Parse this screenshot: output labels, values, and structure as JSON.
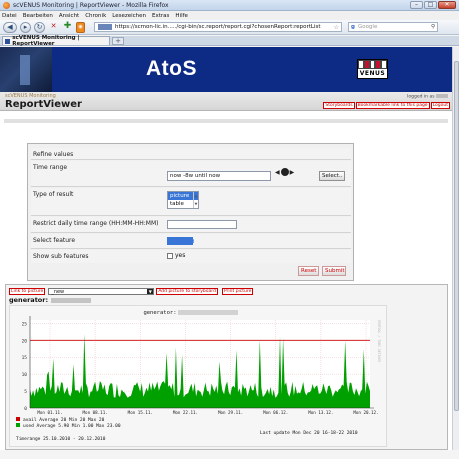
{
  "window": {
    "title": "scVENUS Monitoring | ReportViewer - Mozilla Firefox",
    "buttons": {
      "minimize": "–",
      "maximize": "□",
      "close": "✕"
    }
  },
  "menu": [
    "Datei",
    "Bearbeiten",
    "Ansicht",
    "Chronik",
    "Lesezeichen",
    "Extras",
    "Hilfe"
  ],
  "nav": {
    "url": "https://scmon-lic.in...../cgi-bin/sc.report/report.cgi?chosenReport:reportList",
    "search_placeholder": "Google",
    "search_engine_glyph": "g"
  },
  "tab": {
    "label": "scVENUS Monitoring | ReportViewer",
    "new_tab": "+"
  },
  "banner": {
    "logo": "AtoS",
    "product_logo": "VENUS"
  },
  "subheader": {
    "app_name": "scVENUS Monitoring",
    "page_title": "ReportViewer",
    "logged_in": "logged in as",
    "links": [
      "Storyboards",
      "Bookmarkable link to this page",
      "Logout"
    ]
  },
  "refine": {
    "title": "Refine values",
    "time_range_label": "Time range",
    "time_range_value": "now -8w until now",
    "select_button": "Select..",
    "type_label": "Type of result",
    "type_options": [
      "picture",
      "table"
    ],
    "type_selected": "picture",
    "daily_label": "Restrict daily time range (HH:MM-HH:MM)",
    "daily_value": "",
    "feature_label": "Select feature",
    "feature_value": "redacted",
    "sub_label": "Show sub features",
    "sub_yes": "yes",
    "reset_button": "Reset",
    "submit_button": "Submit"
  },
  "chart_panel": {
    "link_to_picture": "Link to picture",
    "dropdown_value": "_new",
    "add_to_storyboard": "Add picture to storyboard",
    "print_picture": "Print picture",
    "generator_label": "generator:"
  },
  "chart_data": {
    "type": "area",
    "title": "generator:",
    "y_ticks": [
      0,
      5,
      10,
      15,
      20,
      25
    ],
    "ylim": [
      0,
      26
    ],
    "x_tick_labels": [
      "Mon 01.11.",
      "Mon 08.11.",
      "Mon 15.11.",
      "Mon 22.11.",
      "Mon 29.11.",
      "Mon 06.12.",
      "Mon 13.12.",
      "Mon 20.12."
    ],
    "grid": true,
    "series": [
      {
        "name": "avail",
        "color": "#cc0000",
        "kind": "line",
        "average": 20,
        "min": 20,
        "max": 20,
        "constant": 20
      },
      {
        "name": "used",
        "color": "#00a000",
        "kind": "area",
        "average": 5.9,
        "min": 1.0,
        "max": 23.0
      }
    ],
    "legend": [
      "avail  Average 20   Min 20   Max 20",
      "used   Average 5.90   Min 1.00   Max 23.00"
    ],
    "timerange_text": "Timerange 25.10.2010 - 20.12.2010",
    "last_update_text": "Last update Mon Dec 20 16-18-22 2010",
    "side_text": "RRDTOOL / TOBI OETIKER"
  }
}
